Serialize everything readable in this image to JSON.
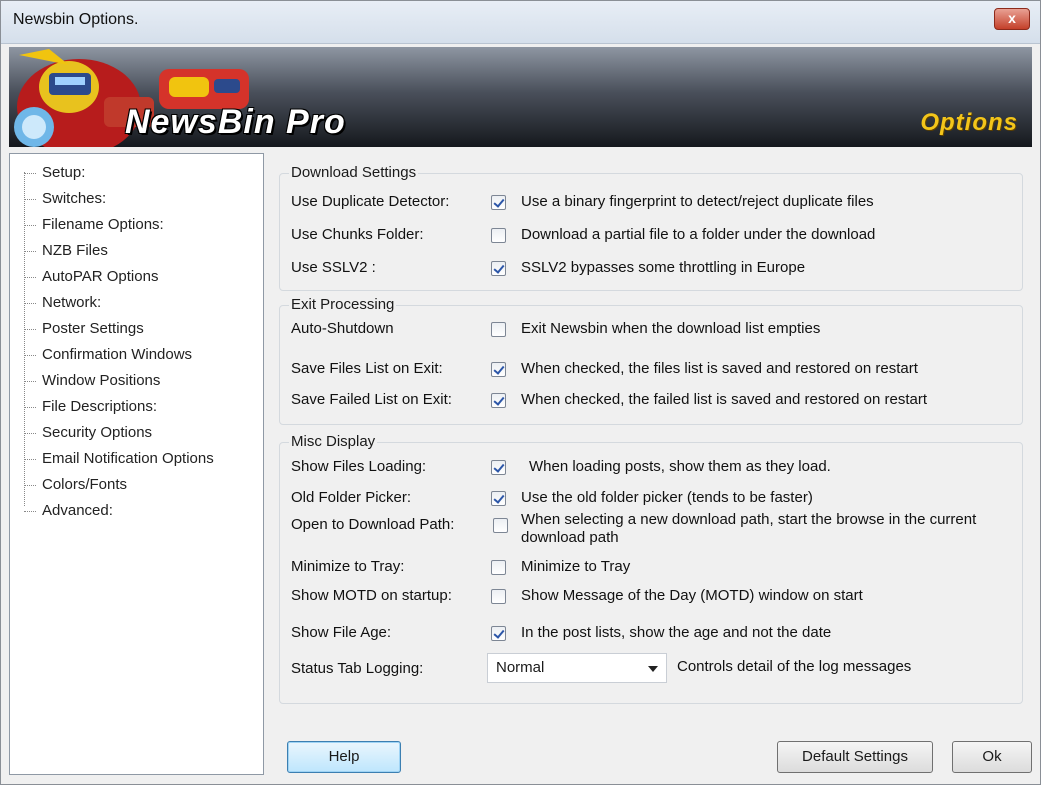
{
  "window": {
    "title": "Newsbin Options.",
    "close_label": "x"
  },
  "banner": {
    "logo": "NewsBin Pro",
    "section": "Options"
  },
  "nav": {
    "items": [
      "Setup:",
      "Switches:",
      "Filename Options:",
      "NZB Files",
      "AutoPAR Options",
      "Network:",
      "Poster Settings",
      "Confirmation Windows",
      "Window Positions",
      "File Descriptions:",
      "Security Options",
      "Email Notification Options",
      "Colors/Fonts",
      "Advanced:"
    ]
  },
  "groups": {
    "download": {
      "title": "Download Settings",
      "rows": [
        {
          "label": "Use Duplicate Detector:",
          "checked": true,
          "desc": "Use a binary fingerprint to detect/reject duplicate files"
        },
        {
          "label": "Use Chunks Folder:",
          "checked": false,
          "desc": "Download a partial file to a folder under the download"
        },
        {
          "label": "Use SSLV2 :",
          "checked": true,
          "desc": "SSLV2 bypasses some throttling in Europe"
        }
      ]
    },
    "exit": {
      "title": "Exit Processing",
      "rows": [
        {
          "label": "Auto-Shutdown",
          "checked": false,
          "desc": "Exit Newsbin when the download list empties"
        },
        {
          "label": "Save Files List on Exit:",
          "checked": true,
          "desc": "When checked, the files list is saved and restored on restart"
        },
        {
          "label": "Save Failed List on Exit:",
          "checked": true,
          "desc": "When checked, the failed list is saved and restored on restart"
        }
      ]
    },
    "misc": {
      "title": "Misc Display",
      "rows": [
        {
          "label": "Show Files Loading:",
          "checked": true,
          "desc": "When loading posts, show them as they load."
        },
        {
          "label": "Old Folder Picker:",
          "checked": true,
          "desc": "Use the old folder picker (tends to be faster)"
        },
        {
          "label": "Open to Download Path:",
          "checked": false,
          "desc": "When selecting a new download path, start the browse in the current download path"
        },
        {
          "label": "Minimize to Tray:",
          "checked": false,
          "desc": "Minimize to Tray"
        },
        {
          "label": "Show MOTD on startup:",
          "checked": false,
          "desc": "Show Message of the Day (MOTD) window on start"
        },
        {
          "label": "Show File Age:",
          "checked": true,
          "desc": "In the post lists, show the age and not the date"
        }
      ],
      "logging": {
        "label": "Status Tab Logging:",
        "value": "Normal",
        "desc": "Controls detail of the log messages"
      }
    }
  },
  "buttons": {
    "help": "Help",
    "default": "Default Settings",
    "ok": "Ok"
  },
  "colors": {
    "accent": "#f3c51a",
    "check": "#2c56a8",
    "help_button": "#bee6fd"
  }
}
